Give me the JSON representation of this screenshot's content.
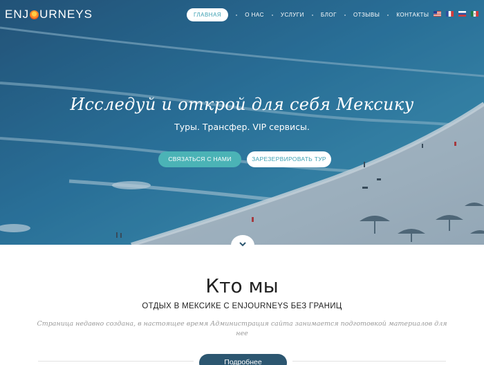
{
  "logo": {
    "prefix": "ENJ",
    "suffix": "URNEYS"
  },
  "nav": {
    "items": [
      {
        "label": "ГЛАВНАЯ",
        "active": true
      },
      {
        "label": "О НАС"
      },
      {
        "label": "УСЛУГИ"
      },
      {
        "label": "БЛОГ"
      },
      {
        "label": "ОТЗЫВЫ"
      },
      {
        "label": "КОНТАКТЫ"
      }
    ],
    "languages": [
      "us-flag-icon",
      "fr-flag-icon",
      "ru-flag-icon",
      "mx-flag-icon"
    ]
  },
  "hero": {
    "title": "Исследуй и открой для себя Мексику",
    "subtitle": "Туры. Трансфер. VIP сервисы.",
    "contact_button": "СВЯЗАТЬСЯ С НАМИ",
    "book_button": "ЗАРЕЗЕРВИРОВАТЬ ТУР"
  },
  "about": {
    "title": "Кто мы",
    "subtitle": "ОТДЫХ В МЕКСИКЕ С ENJOURNEYS БЕЗ ГРАНИЦ",
    "text": "Страница недавно создана, в настоящее время Администрация сайта занимается подготовкой материалов для нее",
    "more_button": "Подробнее"
  },
  "colors": {
    "accent": "#4bb3b6",
    "accent_text": "#3b9fb2",
    "dark_button": "#2c5670"
  }
}
